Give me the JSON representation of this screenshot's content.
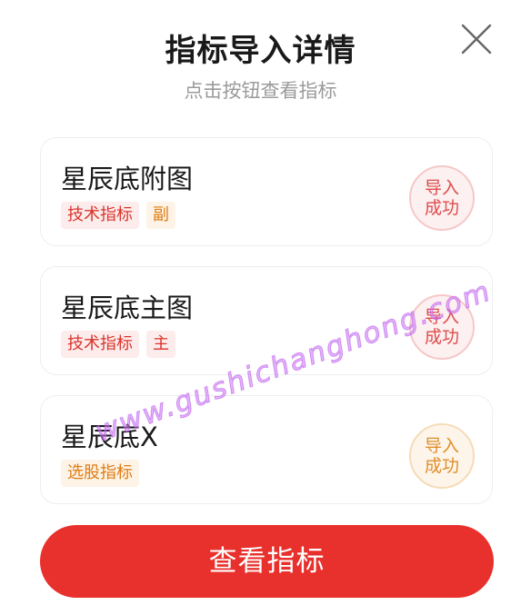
{
  "header": {
    "title": "指标导入详情",
    "subtitle": "点击按钮查看指标"
  },
  "indicators": [
    {
      "name": "星辰底附图",
      "tags": [
        {
          "label": "技术指标",
          "tone": "red"
        },
        {
          "label": "副",
          "tone": "orange"
        }
      ],
      "status_line1": "导入",
      "status_line2": "成功",
      "status_tone": "red"
    },
    {
      "name": "星辰底主图",
      "tags": [
        {
          "label": "技术指标",
          "tone": "red"
        },
        {
          "label": "主",
          "tone": "red"
        }
      ],
      "status_line1": "导入",
      "status_line2": "成功",
      "status_tone": "red"
    },
    {
      "name": "星辰底X",
      "tags": [
        {
          "label": "选股指标",
          "tone": "orange"
        }
      ],
      "status_line1": "导入",
      "status_line2": "成功",
      "status_tone": "orange"
    }
  ],
  "footer": {
    "button_label": "查看指标"
  },
  "watermark": {
    "text": "www.gushichanghong.com"
  },
  "colors": {
    "accent": "#e8302c",
    "tag_red": "#d9342b",
    "tag_orange": "#e07b13"
  },
  "icons": {
    "close": "close-icon"
  }
}
